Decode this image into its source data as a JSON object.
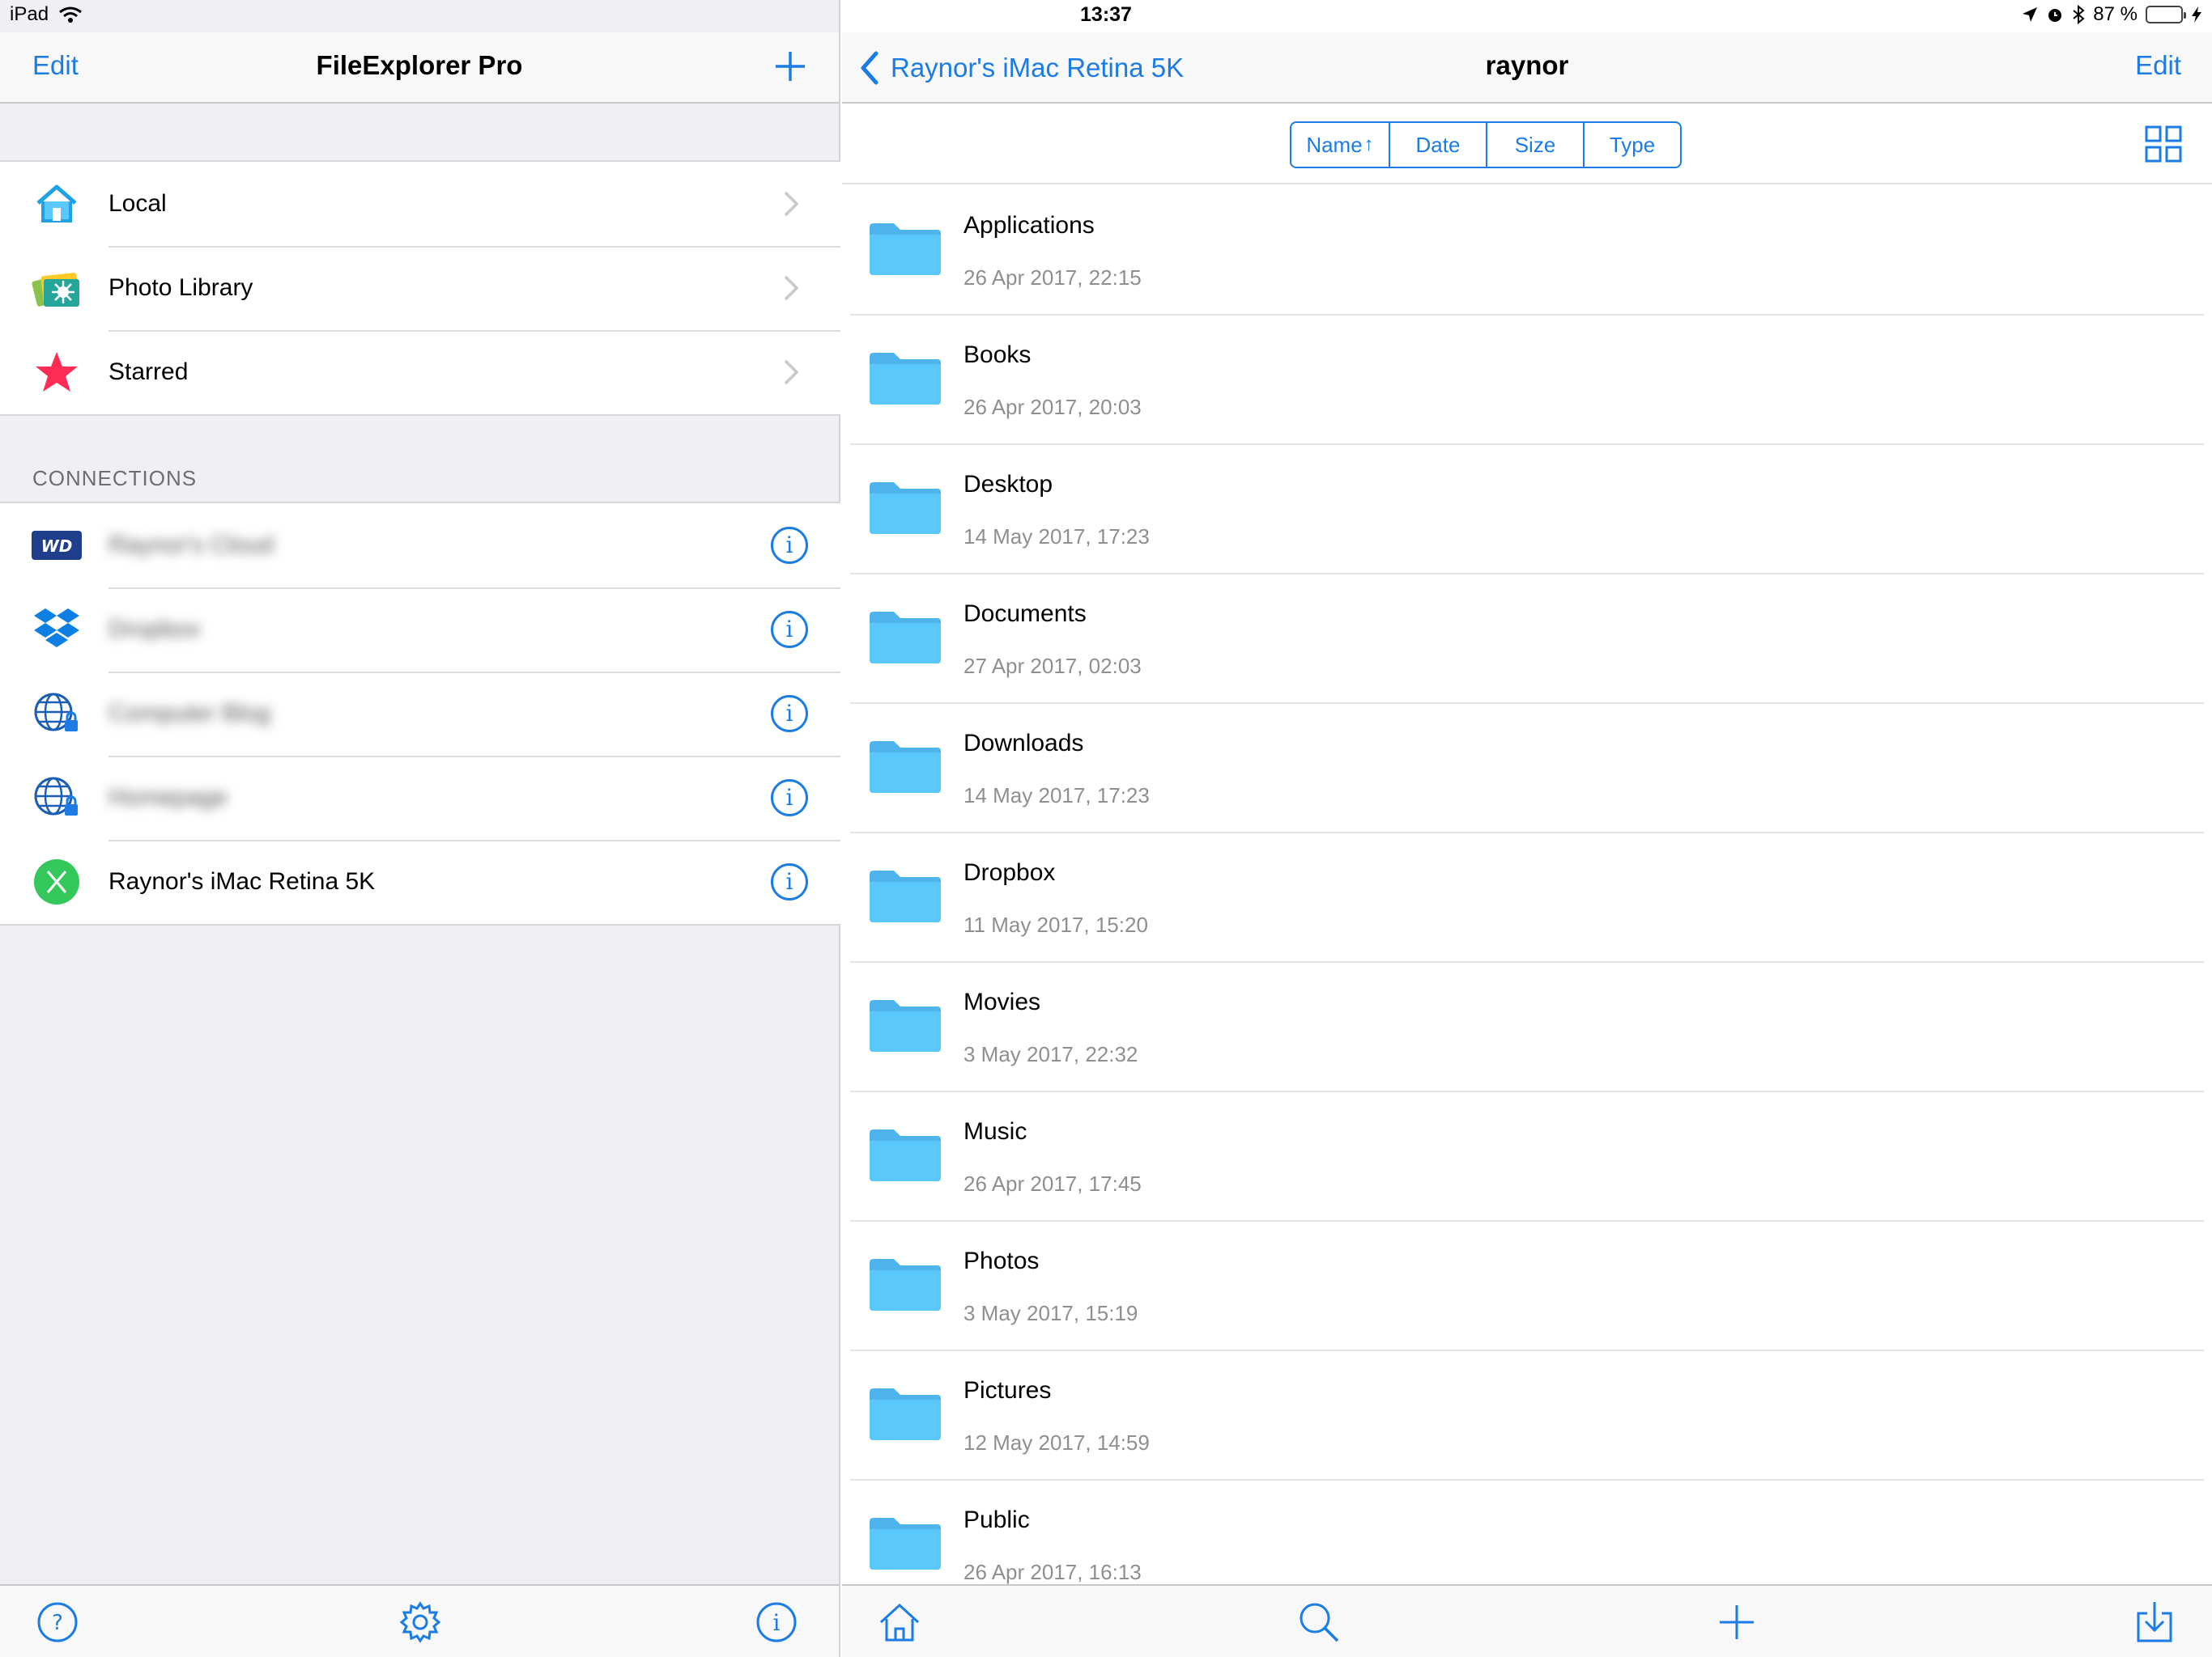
{
  "status_bar": {
    "device": "iPad",
    "time": "13:37",
    "battery": "87 %",
    "battery_level": 0.87
  },
  "left": {
    "title": "FileExplorer Pro",
    "edit_label": "Edit",
    "locations": [
      {
        "label": "Local",
        "icon": "house-icon"
      },
      {
        "label": "Photo Library",
        "icon": "photo-library-icon"
      },
      {
        "label": "Starred",
        "icon": "star-icon"
      }
    ],
    "connections_header": "CONNECTIONS",
    "connections": [
      {
        "label": "Raynor's Cloud",
        "icon": "wd-icon",
        "blurred": true
      },
      {
        "label": "Dropbox",
        "icon": "dropbox-icon",
        "blurred": true
      },
      {
        "label": "Computer Blog",
        "icon": "globe-lock-icon",
        "blurred": true
      },
      {
        "label": "Homepage",
        "icon": "globe-lock-icon",
        "blurred": true
      },
      {
        "label": "Raynor's iMac Retina 5K",
        "icon": "osx-server-icon",
        "blurred": false
      }
    ]
  },
  "right": {
    "back_label": "Raynor's iMac Retina 5K",
    "title": "raynor",
    "edit_label": "Edit",
    "sort": [
      "Name",
      "Date",
      "Size",
      "Type"
    ],
    "sort_arrow": "↑",
    "files": [
      {
        "name": "Applications",
        "date": "26 Apr 2017, 22:15"
      },
      {
        "name": "Books",
        "date": "26 Apr 2017, 20:03"
      },
      {
        "name": "Desktop",
        "date": "14 May 2017, 17:23"
      },
      {
        "name": "Documents",
        "date": "27 Apr 2017, 02:03"
      },
      {
        "name": "Downloads",
        "date": "14 May 2017, 17:23"
      },
      {
        "name": "Dropbox",
        "date": "11 May 2017, 15:20"
      },
      {
        "name": "Movies",
        "date": "3 May 2017, 22:32"
      },
      {
        "name": "Music",
        "date": "26 Apr 2017, 17:45"
      },
      {
        "name": "Photos",
        "date": "3 May 2017, 15:19"
      },
      {
        "name": "Pictures",
        "date": "12 May 2017, 14:59"
      },
      {
        "name": "Public",
        "date": "26 Apr 2017, 16:13"
      }
    ]
  },
  "colors": {
    "accent": "#1a7ce4",
    "folder": "#5ac8fa",
    "star": "#ff2d55",
    "server": "#34c759"
  }
}
